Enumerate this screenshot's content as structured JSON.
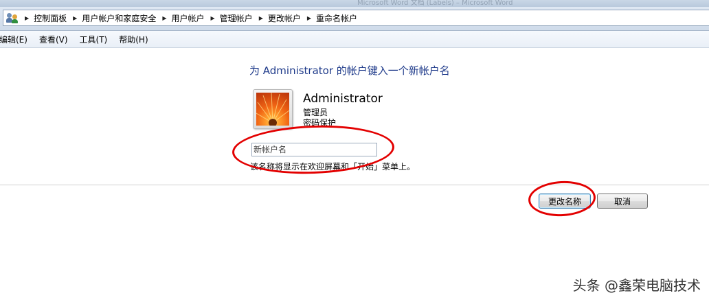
{
  "window": {
    "ghost_title": "Microsoft Word 文档 (Labels) – Microsoft Word"
  },
  "address_bar": {
    "icon": "user-accounts-icon",
    "breadcrumbs": [
      "控制面板",
      "用户帐户和家庭安全",
      "用户帐户",
      "管理帐户",
      "更改帐户",
      "重命名帐户"
    ]
  },
  "menu": {
    "items": [
      "编辑(E)",
      "查看(V)",
      "工具(T)",
      "帮助(H)"
    ]
  },
  "main": {
    "heading": "为 Administrator 的帐户键入一个新帐户名",
    "account": {
      "picture": "orange-flower-picture",
      "name": "Administrator",
      "role": "管理员",
      "extra": "密码保护"
    },
    "new_name_input": {
      "value": "",
      "placeholder": "新帐户名"
    },
    "hint": "该名称将显示在欢迎屏幕和「开始」菜单上。",
    "buttons": {
      "change_name": "更改名称",
      "cancel": "取消"
    }
  },
  "annotations": {
    "color": "#e30000"
  },
  "watermark": "头条 @鑫荣电脑技术"
}
